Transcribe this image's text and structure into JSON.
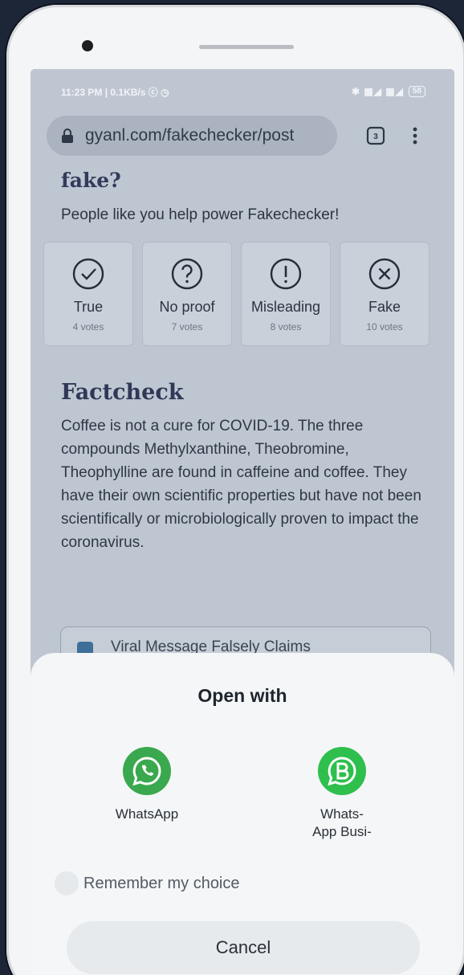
{
  "status_bar": {
    "left": "11:23 PM | 0.1KB/s ⓒ ◷",
    "icons": "✱ ▩◢ ▩◢",
    "battery": "58"
  },
  "browser": {
    "url": "gyanl.com/fakechecker/post",
    "tab_count": "3"
  },
  "article": {
    "heading": "fake?",
    "subtitle": "People like you help power Fakechecker!",
    "votes": [
      {
        "label": "True",
        "count": "4 votes",
        "icon": "check-circle-icon"
      },
      {
        "label": "No proof",
        "count": "7 votes",
        "icon": "question-circle-icon"
      },
      {
        "label": "Misleading",
        "count": "8 votes",
        "icon": "exclamation-circle-icon"
      },
      {
        "label": "Fake",
        "count": "10 votes",
        "icon": "x-circle-icon"
      }
    ],
    "factcheck_heading": "Factcheck",
    "factcheck_body": "Coffee is not a cure for COVID-19. The three compounds Methylxanthine, Theobromine, Theophylline are found in caffeine and coffee. They have their own scientific properties but have not been scientifically or microbiologically proven to impact the coronavirus.",
    "related_link": "Viral Message Falsely Claims"
  },
  "dialog": {
    "title": "Open with",
    "apps": [
      {
        "label": "WhatsApp",
        "icon": "whatsapp-icon",
        "color": "#3aa84e"
      },
      {
        "label": "Whats-\nApp Busi-",
        "icon": "whatsapp-business-icon",
        "color": "#2fbf4d"
      }
    ],
    "remember_label": "Remember my choice",
    "cancel_label": "Cancel"
  }
}
